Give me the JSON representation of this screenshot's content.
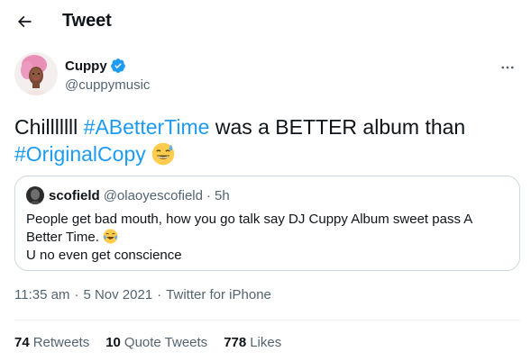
{
  "header": {
    "title": "Tweet"
  },
  "author": {
    "name": "Cuppy",
    "handle": "@cuppymusic",
    "verified": true
  },
  "tweet": {
    "text_pre": "Chilllllll ",
    "hashtag1": "#ABetterTime",
    "text_mid": " was a BETTER album than ",
    "hashtag2": "#OriginalCopy",
    "emoji": "sweat-smile-emoji"
  },
  "quote": {
    "name": "scofield",
    "handle": "@olaoyescofield",
    "dot": "·",
    "time": "5h",
    "line1": "People get bad mouth, how you go talk say DJ Cuppy Album sweet pass A Better Time.",
    "emoji": "tears-of-joy-emoji",
    "line2": "U no even get conscience"
  },
  "meta": {
    "time": "11:35 am",
    "date": "5 Nov 2021",
    "source": "Twitter for iPhone",
    "sep": "·"
  },
  "stats": {
    "retweets_count": "74",
    "retweets_label": "Retweets",
    "quotes_count": "10",
    "quotes_label": "Quote Tweets",
    "likes_count": "778",
    "likes_label": "Likes"
  },
  "colors": {
    "accent": "#1d9bf0",
    "secondary_text": "#536471",
    "border": "#cfd9de"
  }
}
